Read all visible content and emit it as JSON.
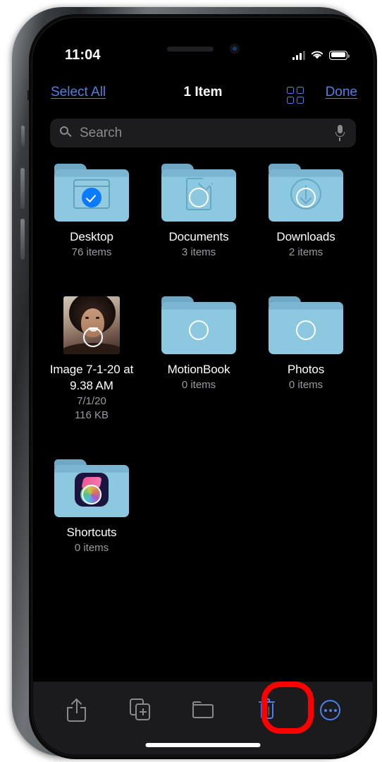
{
  "status_bar": {
    "time": "11:04",
    "cellular_icon": "signal-bars-icon",
    "wifi_icon": "wifi-icon",
    "battery_icon": "battery-icon"
  },
  "nav_bar": {
    "select_all_label": "Select All",
    "title": "1 Item",
    "grid_view_icon": "grid-view-icon",
    "done_label": "Done"
  },
  "search": {
    "placeholder": "Search",
    "value": "",
    "search_icon": "search-icon",
    "mic_icon": "microphone-icon"
  },
  "files": [
    {
      "name": "Desktop",
      "detail": "76 items",
      "detail2": "",
      "kind": "folder",
      "glyph": "window-glyph",
      "selected": true
    },
    {
      "name": "Documents",
      "detail": "3 items",
      "detail2": "",
      "kind": "folder",
      "glyph": "document-glyph",
      "selected": false
    },
    {
      "name": "Downloads",
      "detail": "2 items",
      "detail2": "",
      "kind": "folder",
      "glyph": "download-glyph",
      "selected": false
    },
    {
      "name": "Image 7-1-20 at 9.38 AM",
      "detail": "7/1/20",
      "detail2": "116 KB",
      "kind": "photo",
      "glyph": "photo-thumbnail",
      "selected": false
    },
    {
      "name": "MotionBook",
      "detail": "0 items",
      "detail2": "",
      "kind": "folder",
      "glyph": "",
      "selected": false
    },
    {
      "name": "Photos",
      "detail": "0 items",
      "detail2": "",
      "kind": "folder",
      "glyph": "",
      "selected": false
    },
    {
      "name": "Shortcuts",
      "detail": "0 items",
      "detail2": "",
      "kind": "folder",
      "glyph": "shortcuts-app-glyph",
      "selected": false
    }
  ],
  "toolbar": {
    "share_icon": "share-icon",
    "duplicate_icon": "duplicate-icon",
    "new_folder_icon": "folder-icon",
    "delete_icon": "trash-icon",
    "more_icon": "more-circle-icon"
  },
  "annotation": {
    "highlight_color": "#fe0000",
    "target": "trash-icon"
  },
  "colors": {
    "accent_blue": "#4d81e8",
    "selection_blue": "#0a7bff",
    "folder_blue": "#8cc8e0",
    "screen_bg": "#000000",
    "toolbar_bg": "#1b1b1d",
    "search_bg": "#1c1c1e",
    "subtext_gray": "#9c9ca1"
  }
}
